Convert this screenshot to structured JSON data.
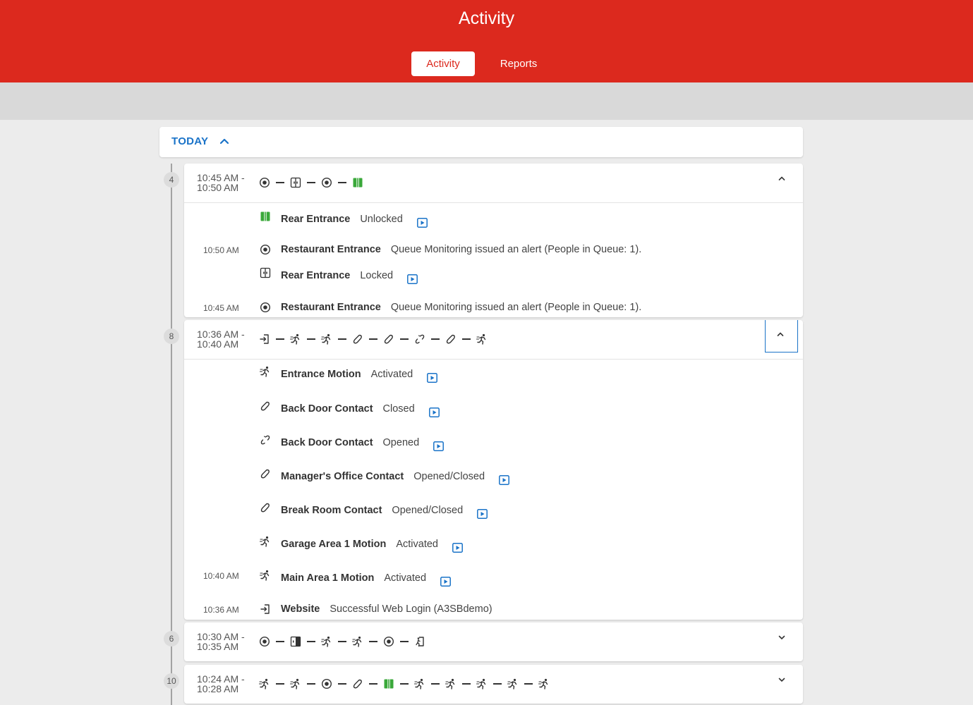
{
  "header": {
    "title": "Activity",
    "tabs": [
      {
        "label": "Activity",
        "active": true
      },
      {
        "label": "Reports",
        "active": false
      }
    ]
  },
  "section": {
    "label": "TODAY",
    "expanded": true
  },
  "colors": {
    "brand": "#dc291e",
    "accent": "#1a73c8",
    "green": "#3aa83a"
  },
  "groups": [
    {
      "count": "4",
      "range_start": "10:45 AM -",
      "range_end": "10:50 AM",
      "expanded": true,
      "summary_icons": [
        "target-icon",
        "door-icon",
        "target-icon",
        "door-unlocked-icon"
      ],
      "events": [
        {
          "time": "",
          "icon": "door-unlocked-icon",
          "device": "Rear Entrance",
          "status": "Unlocked",
          "video": true
        },
        {
          "time": "10:50 AM",
          "icon": "target-icon",
          "device": "Restaurant Entrance",
          "status": "Queue Monitoring issued an alert (People in Queue: 1).",
          "video": false
        },
        {
          "time": "",
          "icon": "door-icon",
          "device": "Rear Entrance",
          "status": "Locked",
          "video": true
        },
        {
          "time": "10:45 AM",
          "icon": "target-icon",
          "device": "Restaurant Entrance",
          "status": "Queue Monitoring issued an alert (People in Queue: 1).",
          "video": false
        }
      ]
    },
    {
      "count": "8",
      "range_start": "10:36 AM -",
      "range_end": "10:40 AM",
      "expanded": true,
      "summary_icons": [
        "login-icon",
        "motion-icon",
        "motion-icon",
        "contact-closed-icon",
        "contact-closed-icon",
        "contact-open-icon",
        "contact-closed-icon",
        "motion-icon"
      ],
      "events": [
        {
          "time": "",
          "icon": "motion-icon",
          "device": "Entrance Motion",
          "status": "Activated",
          "video": true
        },
        {
          "time": "",
          "icon": "contact-closed-icon",
          "device": "Back Door Contact",
          "status": "Closed",
          "video": true
        },
        {
          "time": "",
          "icon": "contact-open-icon",
          "device": "Back Door Contact",
          "status": "Opened",
          "video": true
        },
        {
          "time": "",
          "icon": "contact-closed-icon",
          "device": "Manager's Office Contact",
          "status": "Opened/Closed",
          "video": true
        },
        {
          "time": "",
          "icon": "contact-closed-icon",
          "device": "Break Room Contact",
          "status": "Opened/Closed",
          "video": true
        },
        {
          "time": "",
          "icon": "motion-icon",
          "device": "Garage Area 1 Motion",
          "status": "Activated",
          "video": true
        },
        {
          "time": "10:40 AM",
          "icon": "motion-icon",
          "device": "Main Area 1 Motion",
          "status": "Activated",
          "video": true
        },
        {
          "time": "10:36 AM",
          "icon": "login-icon",
          "device": "Website",
          "status": "Successful Web Login (A3SBdemo)",
          "video": false
        }
      ]
    },
    {
      "count": "6",
      "range_start": "10:30 AM -",
      "range_end": "10:35 AM",
      "expanded": false,
      "summary_icons": [
        "target-icon",
        "door-open-icon",
        "motion-icon",
        "motion-icon",
        "target-icon",
        "exit-icon"
      ],
      "events": []
    },
    {
      "count": "10",
      "range_start": "10:24 AM -",
      "range_end": "10:28 AM",
      "expanded": false,
      "summary_icons": [
        "motion-icon",
        "motion-icon",
        "target-icon",
        "contact-closed-icon",
        "door-unlocked-icon",
        "motion-icon",
        "motion-icon",
        "motion-icon",
        "motion-icon",
        "motion-icon"
      ],
      "events": []
    }
  ]
}
